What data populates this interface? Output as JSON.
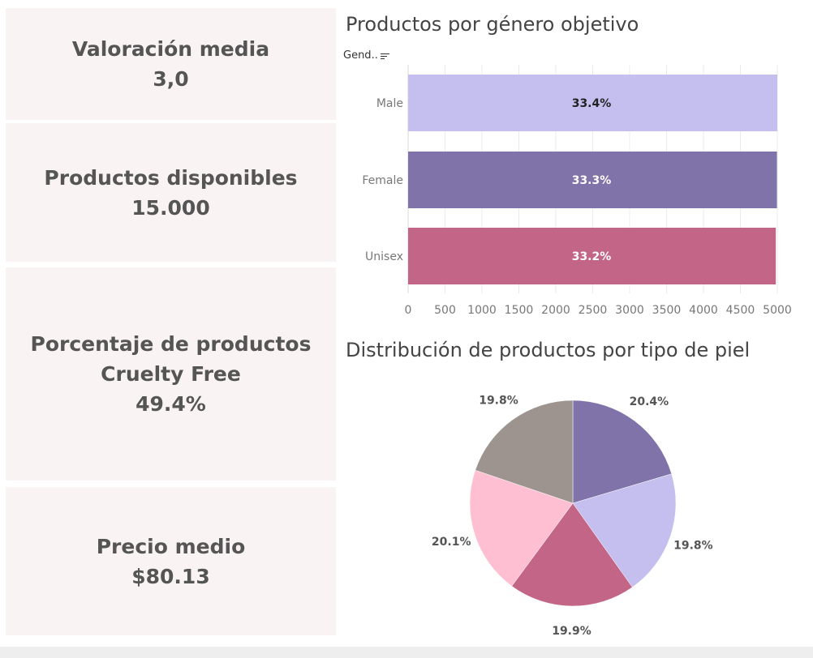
{
  "kpis": [
    {
      "label": "Valoración media",
      "value": "3,0"
    },
    {
      "label": "Productos disponibles",
      "value": "15.000"
    },
    {
      "label": "Porcentaje de productos\nCruelty Free",
      "value": "49.4%"
    },
    {
      "label": "Precio medio",
      "value": "$80.13"
    }
  ],
  "bar_header": "Gend..",
  "colors": {
    "male": "#c5bff0",
    "female": "#8073a9",
    "unisex": "#c36586",
    "pie_grey": "#9d938f",
    "pie_pink": "#ffbfd2",
    "card_bg": "#f9f3f3"
  },
  "chart_data": [
    {
      "type": "bar",
      "orientation": "horizontal",
      "title": "Productos por género objetivo",
      "categories": [
        "Male",
        "Female",
        "Unisex"
      ],
      "values": [
        5010,
        4995,
        4980
      ],
      "labels": [
        "33.4%",
        "33.3%",
        "33.2%"
      ],
      "colors": [
        "#c5bff0",
        "#8073a9",
        "#c36586"
      ],
      "label_colors": [
        "#222222",
        "#ffffff",
        "#ffffff"
      ],
      "xlim": [
        0,
        5000
      ],
      "xticks": [
        0,
        500,
        1000,
        1500,
        2000,
        2500,
        3000,
        3500,
        4000,
        4500,
        5000
      ],
      "grid": true
    },
    {
      "type": "pie",
      "title": "Distribución de productos por tipo de piel",
      "values": [
        20.4,
        19.8,
        19.9,
        20.1,
        19.8
      ],
      "labels": [
        "20.4%",
        "19.8%",
        "19.9%",
        "20.1%",
        "19.8%"
      ],
      "colors": [
        "#8073a9",
        "#c5bff0",
        "#c36586",
        "#ffbfd2",
        "#9d938f"
      ]
    }
  ]
}
